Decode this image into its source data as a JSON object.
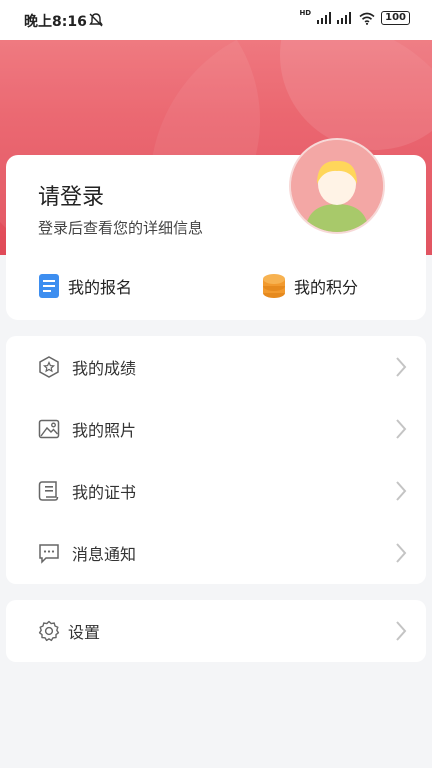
{
  "status_bar": {
    "time": "晚上8:16",
    "battery": "100",
    "network_label": "HD"
  },
  "profile": {
    "title": "请登录",
    "subtitle": "登录后查看您的详细信息"
  },
  "quick_links": [
    {
      "label": "我的报名",
      "icon": "document-icon"
    },
    {
      "label": "我的积分",
      "icon": "coins-icon"
    }
  ],
  "menu": [
    {
      "label": "我的成绩",
      "icon": "shield-star-icon"
    },
    {
      "label": "我的照片",
      "icon": "image-icon"
    },
    {
      "label": "我的证书",
      "icon": "certificate-icon"
    },
    {
      "label": "消息通知",
      "icon": "message-icon"
    }
  ],
  "settings": {
    "label": "设置",
    "icon": "gear-icon"
  },
  "colors": {
    "header_red": "#e85563",
    "page_bg": "#f4f5f7",
    "doc_blue": "#3d8ef0",
    "coin_orange": "#f29a2e"
  }
}
